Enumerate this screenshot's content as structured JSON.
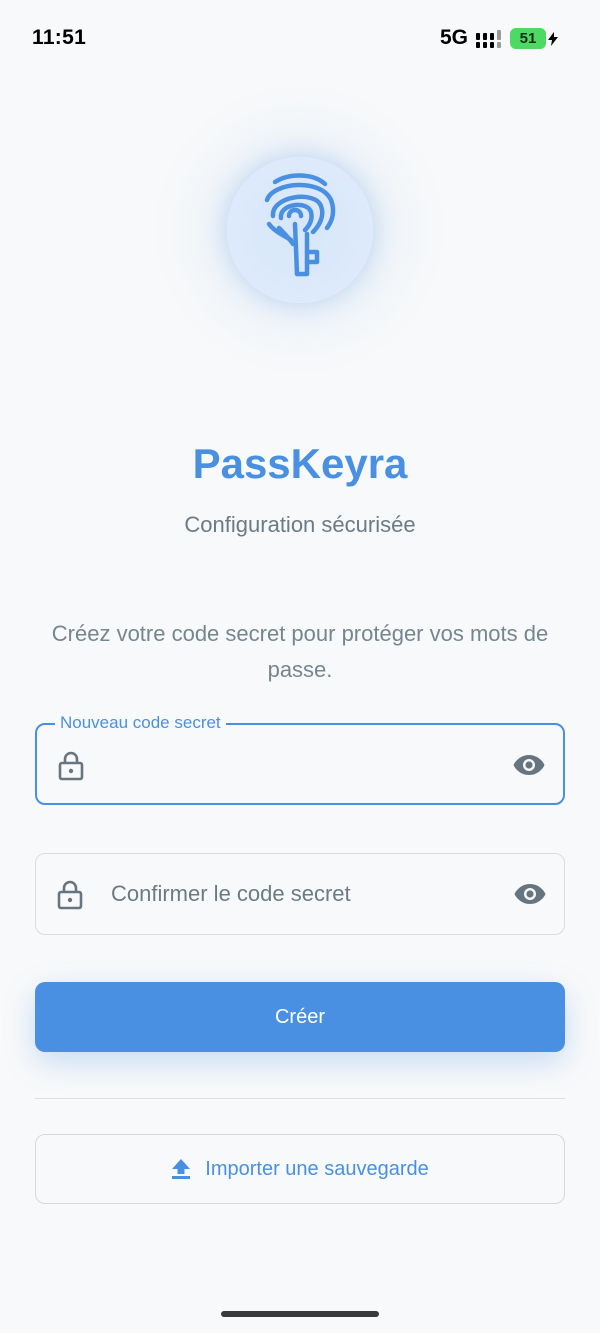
{
  "status_bar": {
    "time": "11:51",
    "network": "5G",
    "battery": "51"
  },
  "app": {
    "title": "PassKeyra",
    "subtitle": "Configuration sécurisée",
    "instructions": "Créez votre code secret pour protéger vos mots de passe."
  },
  "form": {
    "new_code_label": "Nouveau code secret",
    "new_code_value": "",
    "confirm_placeholder": "Confirmer le code secret",
    "confirm_value": ""
  },
  "actions": {
    "create_label": "Créer",
    "import_label": "Importer une sauvegarde"
  },
  "icons": {
    "logo": "fingerprint-key-icon",
    "field_prefix": "lock-icon",
    "field_suffix": "eye-icon",
    "import": "upload-icon"
  },
  "colors": {
    "accent": "#4a90e2",
    "background": "#f8f9fa",
    "muted_text": "#6b7b86",
    "battery": "#4cd964"
  }
}
